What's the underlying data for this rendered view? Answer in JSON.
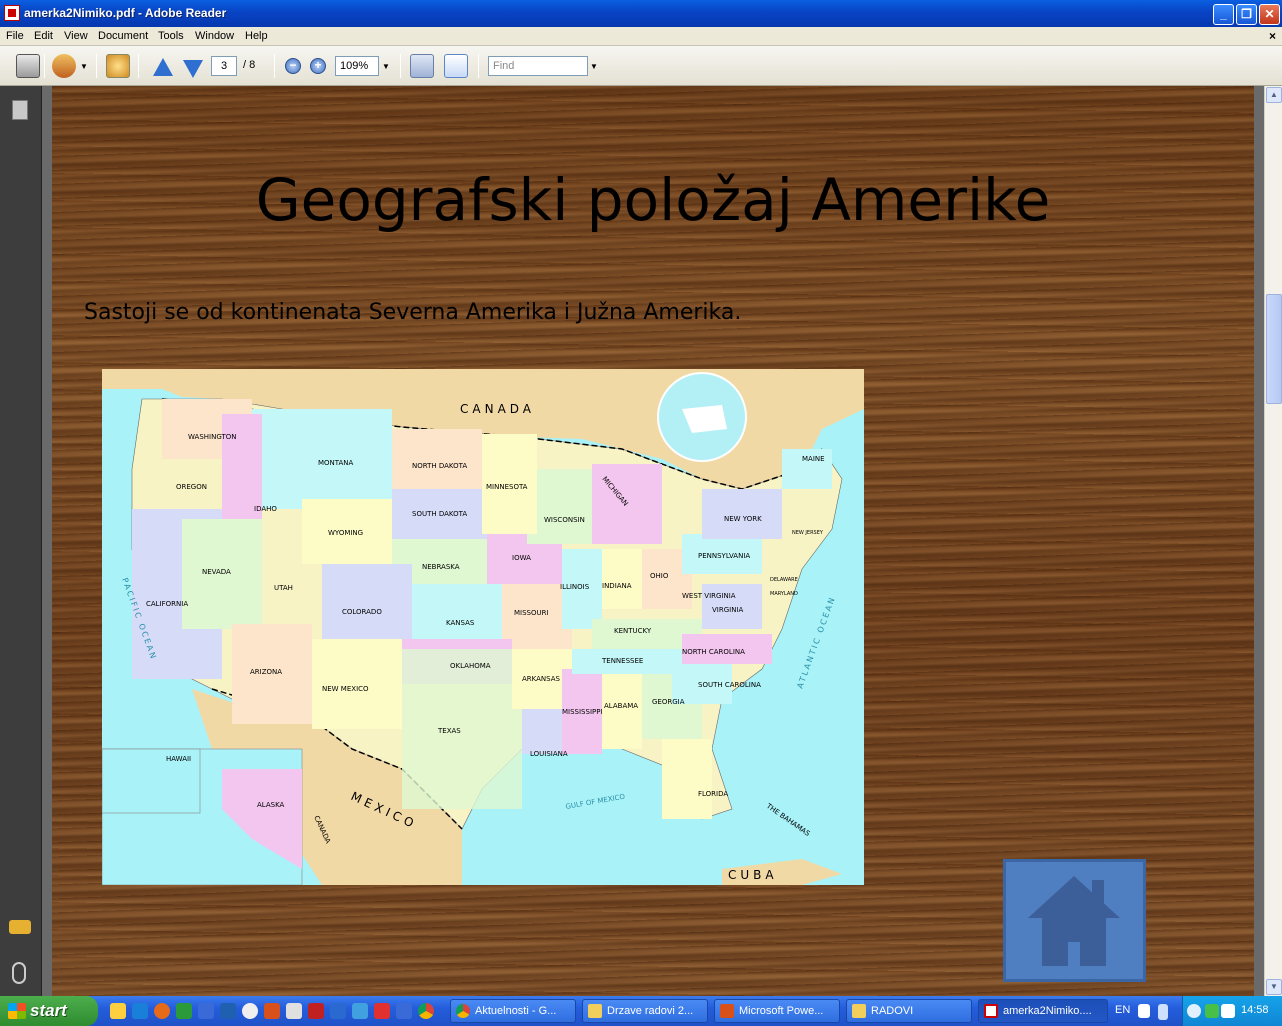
{
  "window": {
    "title": "amerka2Nimiko.pdf - Adobe Reader",
    "minimize": "_",
    "restore": "❐",
    "close": "✕"
  },
  "menu": {
    "items": [
      "File",
      "Edit",
      "View",
      "Document",
      "Tools",
      "Window",
      "Help"
    ],
    "close_doc": "×"
  },
  "toolbar": {
    "page_current": "3",
    "page_total": "/ 8",
    "zoom_value": "109%",
    "zoom_out": "−",
    "zoom_in": "+",
    "find_placeholder": "Find"
  },
  "slide": {
    "title": "Geografski položaj Amerike",
    "subtitle": "Sastoji se od kontinenata Severna Amerika i Južna Amerika."
  },
  "map": {
    "canada": "CANADA",
    "mexico": "MEXICO",
    "cuba": "CUBA",
    "bahamas": "THE BAHAMAS",
    "pacific": "PACIFIC OCEAN",
    "atlantic": "ATLANTIC OCEAN",
    "gulf": "GULF OF MEXICO",
    "canada_small": "CANADA",
    "hawaii": "HAWAII",
    "alaska": "ALASKA",
    "states": [
      {
        "name": "WASHINGTON"
      },
      {
        "name": "OREGON"
      },
      {
        "name": "IDAHO"
      },
      {
        "name": "MONTANA"
      },
      {
        "name": "WYOMING"
      },
      {
        "name": "NORTH DAKOTA"
      },
      {
        "name": "SOUTH DAKOTA"
      },
      {
        "name": "NEBRASKA"
      },
      {
        "name": "MINNESOTA"
      },
      {
        "name": "WISCONSIN"
      },
      {
        "name": "MICHIGAN"
      },
      {
        "name": "IOWA"
      },
      {
        "name": "ILLINOIS"
      },
      {
        "name": "INDIANA"
      },
      {
        "name": "OHIO"
      },
      {
        "name": "NEVADA"
      },
      {
        "name": "UTAH"
      },
      {
        "name": "COLORADO"
      },
      {
        "name": "KANSAS"
      },
      {
        "name": "MISSOURI"
      },
      {
        "name": "CALIFORNIA"
      },
      {
        "name": "ARIZONA"
      },
      {
        "name": "NEW MEXICO"
      },
      {
        "name": "OKLAHOMA"
      },
      {
        "name": "ARKANSAS"
      },
      {
        "name": "TEXAS"
      },
      {
        "name": "LOUISIANA"
      },
      {
        "name": "MISSISSIPPI"
      },
      {
        "name": "ALABAMA"
      },
      {
        "name": "GEORGIA"
      },
      {
        "name": "FLORIDA"
      },
      {
        "name": "TENNESSEE"
      },
      {
        "name": "KENTUCKY"
      },
      {
        "name": "NORTH CAROLINA"
      },
      {
        "name": "SOUTH CAROLINA"
      },
      {
        "name": "VIRGINIA"
      },
      {
        "name": "WEST VIRGINIA"
      },
      {
        "name": "PENNSYLVANIA"
      },
      {
        "name": "NEW YORK"
      },
      {
        "name": "MAINE"
      },
      {
        "name": "NEW JERSEY"
      },
      {
        "name": "DELAWARE"
      },
      {
        "name": "MARYLAND"
      }
    ]
  },
  "taskbar": {
    "start": "start",
    "tasks": [
      "Aktuelnosti - G...",
      "Drzave radovi 2...",
      "Microsoft Powe...",
      "RADOVI",
      "amerka2Nimiko...."
    ],
    "language": "EN",
    "clock": "14:58"
  },
  "colors": {
    "titlebar": "#0843c4",
    "map_water": "#a8f2f8",
    "home_button": "#4f7fc0",
    "taskbar": "#245ddb"
  }
}
